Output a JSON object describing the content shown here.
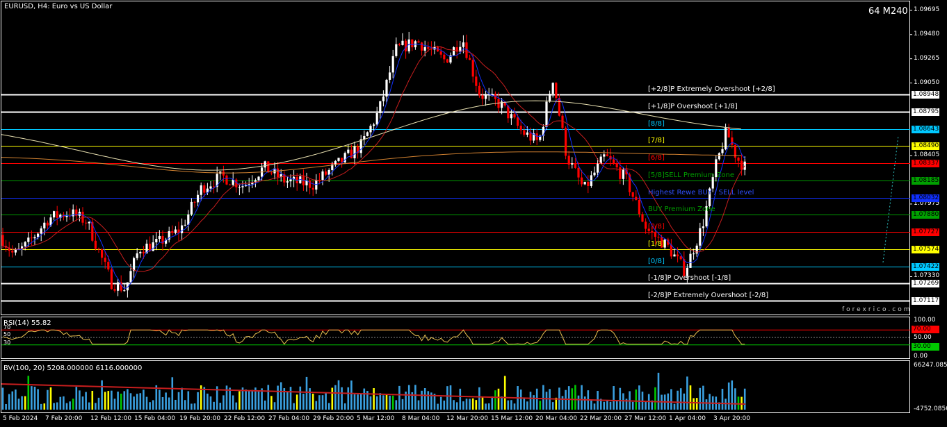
{
  "window": {
    "title": "EURUSD, H4:  Euro vs US Dollar",
    "timeframe_badge": "64 M240",
    "watermark": "forexrico.com"
  },
  "levels": [
    {
      "label": "[+2/8]P Extremely Overshoot [+2/8]",
      "price": "1.08948",
      "color": "#ffffff",
      "tag_bg": "#ffffff",
      "tag_fg": "#000000"
    },
    {
      "label": "[+1/8]P Overshoot [+1/8]",
      "price": "1.08795",
      "color": "#ffffff",
      "tag_bg": "#ffffff",
      "tag_fg": "#000000"
    },
    {
      "label": "[8/8]",
      "price": "1.08643",
      "color": "#00c8ff",
      "tag_bg": "#00c8ff",
      "tag_fg": "#000000"
    },
    {
      "label": "[7/8]",
      "price": "1.08490",
      "color": "#ffff00",
      "tag_bg": "#ffff00",
      "tag_fg": "#000000"
    },
    {
      "label": "[6/8]",
      "price": "1.08337",
      "color": "#ff0000",
      "tag_bg": "#ff0000",
      "tag_fg": "#000000"
    },
    {
      "label": "[5/8]SELL Premium Zone",
      "price": "1.08185",
      "color": "#00a000",
      "tag_bg": "#00a000",
      "tag_fg": "#000000"
    },
    {
      "label": "Highest Rewe BUY / SELL level",
      "price": "1.08032",
      "color": "#1030ff",
      "tag_bg": "#1030ff",
      "tag_fg": "#000000"
    },
    {
      "label": "BUY Premium Zone",
      "price": "1.07880",
      "color": "#00a000",
      "tag_bg": "#00a000",
      "tag_fg": "#000000"
    },
    {
      "label": "[2/8]",
      "price": "1.07727",
      "color": "#ff0000",
      "tag_bg": "#ff0000",
      "tag_fg": "#000000"
    },
    {
      "label": "[1/8]",
      "price": "1.07574",
      "color": "#ffff00",
      "tag_bg": "#ffff00",
      "tag_fg": "#000000"
    },
    {
      "label": "[0/8]",
      "price": "1.07422",
      "color": "#00c8ff",
      "tag_bg": "#00c8ff",
      "tag_fg": "#000000"
    },
    {
      "label": "[-1/8]P Overshoot [-1/8]",
      "price": "1.07269",
      "color": "#ffffff",
      "tag_bg": "#ffffff",
      "tag_fg": "#000000"
    },
    {
      "label": "[-2/8]P Extremely Overshoot [-2/8]",
      "price": "1.07117",
      "color": "#ffffff",
      "tag_bg": "#ffffff",
      "tag_fg": "#000000"
    }
  ],
  "price_axis": [
    "1.09695",
    "1.09480",
    "1.09265",
    "1.09050",
    "1.08405",
    "1.07975",
    "1.07330"
  ],
  "rsi": {
    "title": "RSI(14) 55.82",
    "left_levels": [
      "70",
      "50",
      "30"
    ],
    "axis": [
      "100.00",
      "50.00",
      "0.00"
    ],
    "overbought_tag": "70.00",
    "oversold_tag": "30.00"
  },
  "bv": {
    "title": "BV(100, 20) 5208.000000 6116.000000",
    "axis_top": "66247.0850",
    "axis_bottom": "-4752.0850"
  },
  "dates": [
    "5 Feb 2024",
    "7 Feb 20:00",
    "12 Feb 12:00",
    "15 Feb 04:00",
    "19 Feb 20:00",
    "22 Feb 12:00",
    "27 Feb 04:00",
    "29 Feb 20:00",
    "5 Mar 12:00",
    "8 Mar 04:00",
    "12 Mar 20:00",
    "15 Mar 12:00",
    "20 Mar 04:00",
    "22 Mar 20:00",
    "27 Mar 12:00",
    "1 Apr 04:00",
    "3 Apr 20:00"
  ],
  "colors": {
    "up": "#ffffff",
    "down": "#ff0000",
    "ma_fast": "#1030ff",
    "ma_mid": "#c81e1e",
    "ma_slow": "#e8e0b0",
    "ma_orange": "#d08030",
    "rsi_line": "#e8c050",
    "bv_up": "#3aa0e0"
  }
}
